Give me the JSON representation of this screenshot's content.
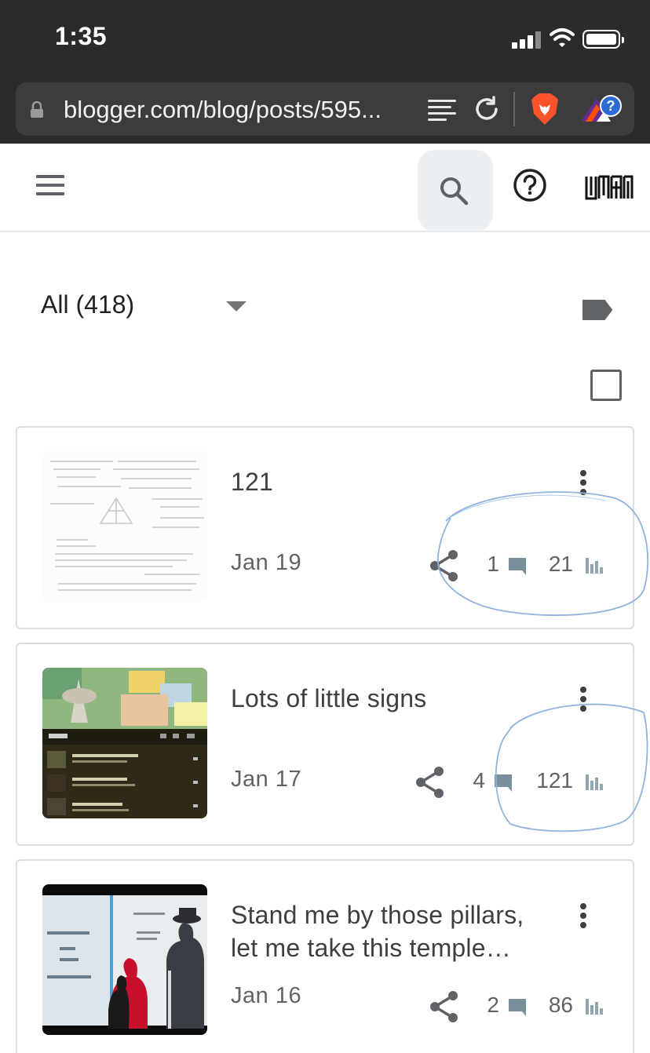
{
  "status_bar": {
    "time": "1:35",
    "icons": [
      "cellular-signal-icon",
      "wifi-icon",
      "battery-icon"
    ]
  },
  "browser": {
    "url": "blogger.com/blog/posts/595...",
    "icons": [
      "lock-icon",
      "reader-mode-icon",
      "reload-icon",
      "brave-shields-icon",
      "brave-rewards-icon"
    ]
  },
  "app_bar": {
    "icons": [
      "menu-icon",
      "search-icon",
      "help-icon",
      "blog-logo-icon"
    ]
  },
  "filter": {
    "label": "All (418)",
    "icons": [
      "dropdown-arrow-icon",
      "label-icon",
      "checkbox-icon"
    ]
  },
  "posts": [
    {
      "title": "121",
      "date": "Jan 19",
      "comments": "1",
      "views": "21"
    },
    {
      "title": "Lots of little signs",
      "date": "Jan 17",
      "comments": "4",
      "views": "121"
    },
    {
      "title": "Stand me by those pillars, let me take this temple…",
      "date": "Jan 16",
      "comments": "2",
      "views": "86"
    }
  ],
  "post_icons": [
    "more-vert-icon",
    "share-icon",
    "comment-icon",
    "stats-icon"
  ],
  "colors": {
    "chrome_bg": "#2b2b2b",
    "url_bg": "#3c3c3c",
    "text_primary": "#3c4043",
    "text_secondary": "#5f6368",
    "comment_icon": "#78909c",
    "annotation_stroke": "#8fb3e0"
  }
}
